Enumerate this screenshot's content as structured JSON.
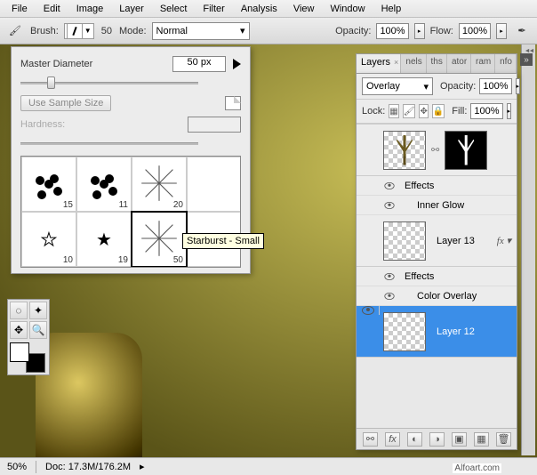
{
  "menu": {
    "items": [
      "File",
      "Edit",
      "Image",
      "Layer",
      "Select",
      "Filter",
      "Analysis",
      "View",
      "Window",
      "Help"
    ]
  },
  "options": {
    "brush_label": "Brush:",
    "brush_size": "50",
    "mode_label": "Mode:",
    "mode_value": "Normal",
    "opacity_label": "Opacity:",
    "opacity_value": "100%",
    "flow_label": "Flow:",
    "flow_value": "100%"
  },
  "brush_picker": {
    "master_label": "Master Diameter",
    "master_value": "50 px",
    "sample_btn": "Use Sample Size",
    "hardness_label": "Hardness:",
    "hardness_value": "",
    "cells": [
      {
        "sz": "15",
        "kind": "spot"
      },
      {
        "sz": "11",
        "kind": "spot"
      },
      {
        "sz": "20",
        "kind": "burst"
      },
      {
        "sz": "",
        "kind": "blank"
      },
      {
        "sz": "10",
        "kind": "star-out"
      },
      {
        "sz": "19",
        "kind": "star5"
      },
      {
        "sz": "50",
        "kind": "burst",
        "sel": true
      },
      {
        "sz": "",
        "kind": "blank"
      }
    ],
    "tooltip": "Starburst - Small"
  },
  "layers_panel": {
    "tabs": [
      "Layers",
      "nels",
      "ths",
      "ator",
      "ram",
      "nfo"
    ],
    "active_tab": 0,
    "blend": "Overlay",
    "opacity_label": "Opacity:",
    "opacity_value": "100%",
    "lock_label": "Lock:",
    "fill_label": "Fill:",
    "fill_value": "100%",
    "layers": [
      {
        "name": "",
        "eye": false,
        "thumbs": "tree",
        "fx": true
      },
      {
        "fx_label": "Effects"
      },
      {
        "sub": "Inner Glow"
      },
      {
        "name": "Layer 13",
        "eye": false,
        "thumbs": "checker",
        "fx": true,
        "fx_tag": "fx"
      },
      {
        "fx_label": "Effects"
      },
      {
        "sub": "Color Overlay"
      },
      {
        "name": "Layer 12",
        "eye": true,
        "thumbs": "checker",
        "sel": true
      }
    ]
  },
  "status": {
    "zoom": "50%",
    "doc": "Doc: 17.3M/176.2M"
  },
  "watermark": "Alfoart.com"
}
